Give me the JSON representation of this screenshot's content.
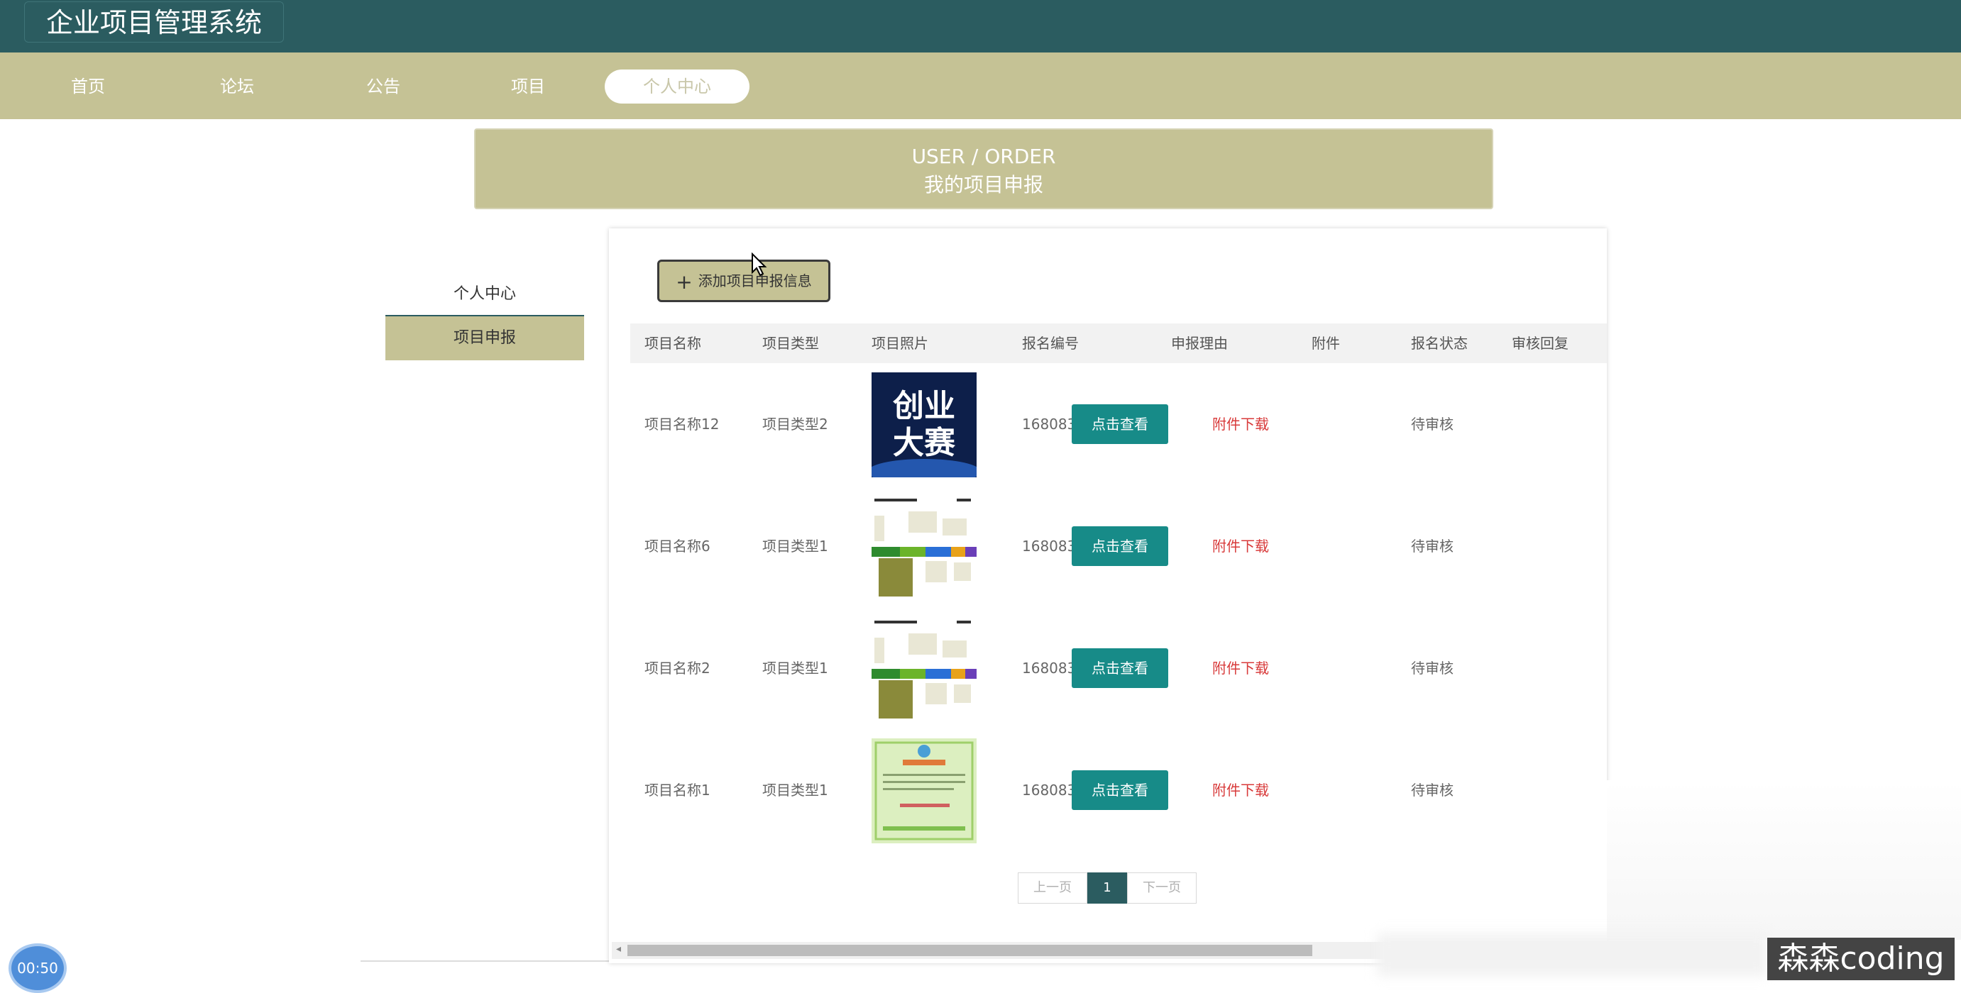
{
  "app": {
    "title": "企业项目管理系统"
  },
  "nav": {
    "items": [
      {
        "label": "首页",
        "active": false
      },
      {
        "label": "论坛",
        "active": false
      },
      {
        "label": "公告",
        "active": false
      },
      {
        "label": "项目",
        "active": false
      },
      {
        "label": "个人中心",
        "active": true
      }
    ]
  },
  "banner": {
    "en": "USER / ORDER",
    "cn": "我的项目申报"
  },
  "sidebar": {
    "items": [
      {
        "label": "个人中心"
      },
      {
        "label": "项目申报"
      }
    ]
  },
  "toolbar": {
    "add_label": "添加项目申报信息",
    "add_icon": "plus-icon"
  },
  "table": {
    "headers": [
      "项目名称",
      "项目类型",
      "项目照片",
      "报名编号",
      "申报理由",
      "附件",
      "报名状态",
      "审核回复"
    ],
    "view_label": "点击查看",
    "download_label": "附件下载",
    "rows": [
      {
        "name": "项目名称12",
        "type": "项目类型2",
        "photo": "创业大赛",
        "code": "1680834847180",
        "status": "待审核",
        "reply": ""
      },
      {
        "name": "项目名称6",
        "type": "项目类型1",
        "photo": "",
        "code": "1680834847223",
        "status": "待审核",
        "reply": ""
      },
      {
        "name": "项目名称2",
        "type": "项目类型1",
        "photo": "",
        "code": "1680834847168",
        "status": "待审核",
        "reply": ""
      },
      {
        "name": "项目名称1",
        "type": "项目类型1",
        "photo": "",
        "code": "1680834847230",
        "status": "待审核",
        "reply": ""
      }
    ]
  },
  "pager": {
    "prev": "上一页",
    "current": "1",
    "next": "下一页"
  },
  "overlay": {
    "timer": "00:50",
    "watermark": "森森coding"
  },
  "colors": {
    "header": "#2b5c60",
    "khaki": "#c5c295",
    "teal_button": "#178b88",
    "link_red": "#d83a3a"
  }
}
